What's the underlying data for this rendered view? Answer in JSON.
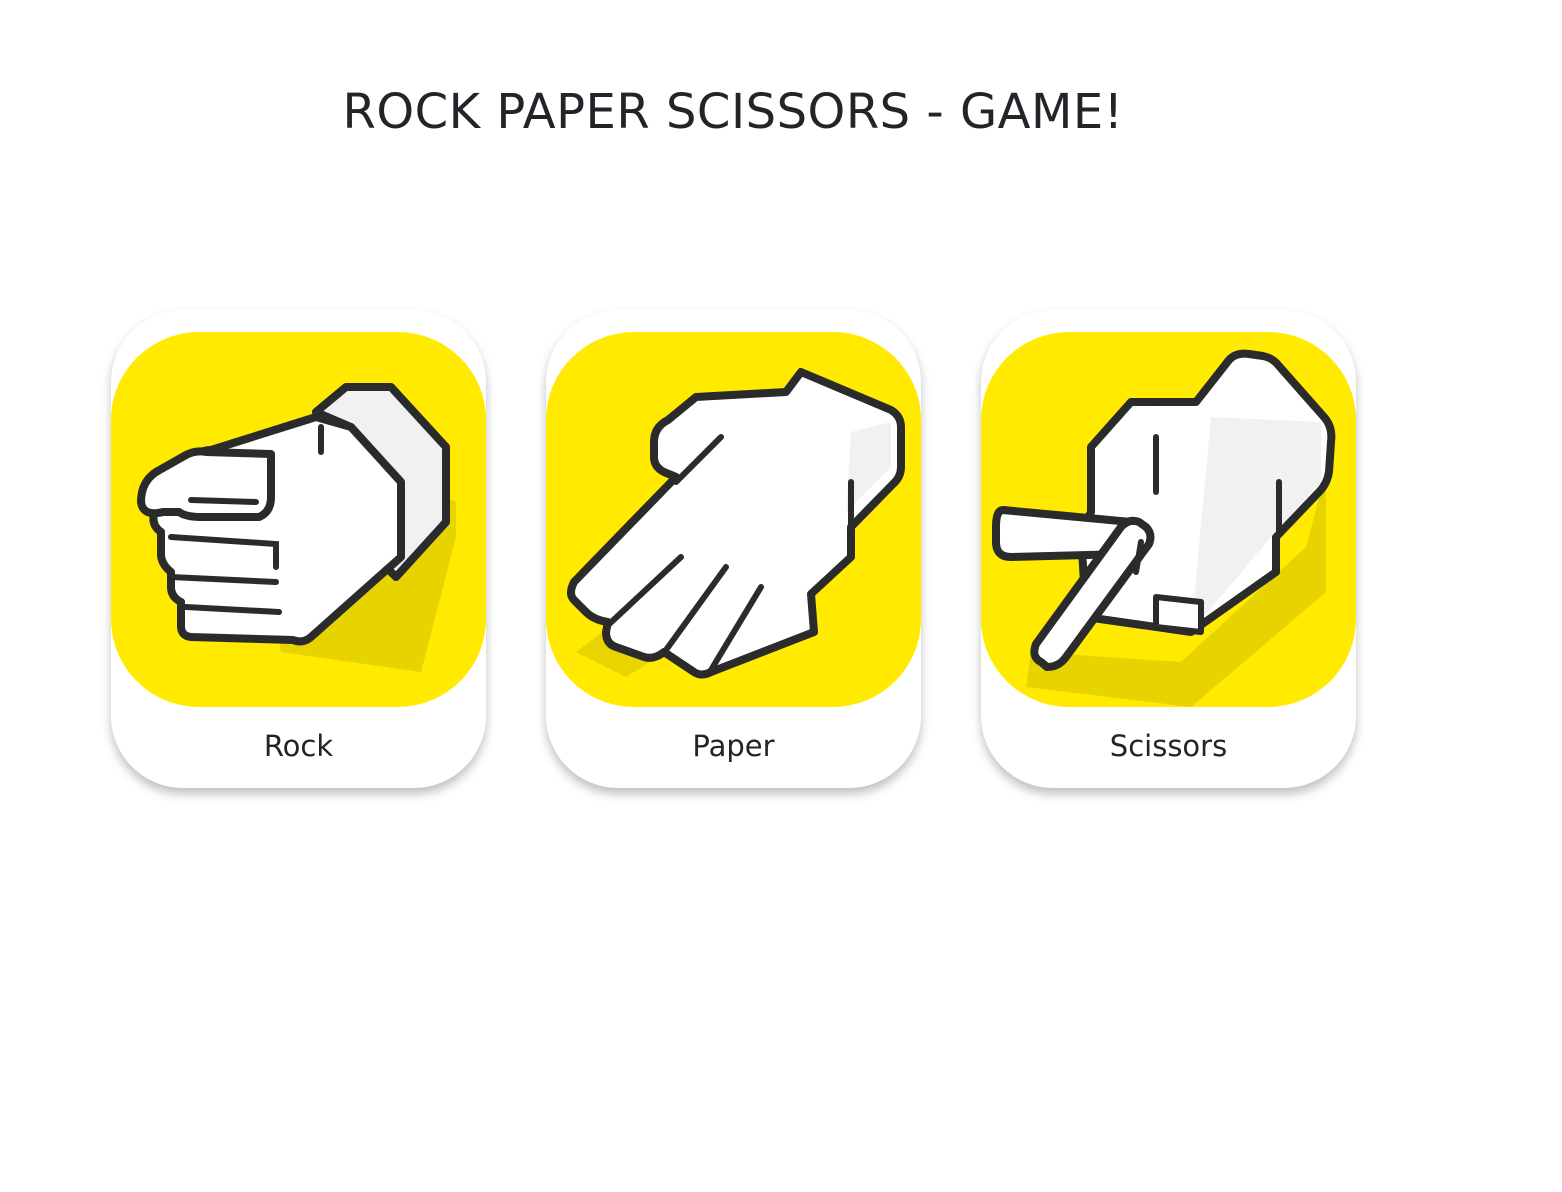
{
  "title": "ROCK PAPER SCISSORS - GAME!",
  "choices": [
    {
      "label": "Rock",
      "icon": "rock-hand-icon"
    },
    {
      "label": "Paper",
      "icon": "paper-hand-icon"
    },
    {
      "label": "Scissors",
      "icon": "scissors-hand-icon"
    }
  ],
  "colors": {
    "card_art_background": "#ffea00",
    "hand_fill": "#ffffff",
    "outline": "#2b2b2b",
    "text": "#212529"
  }
}
